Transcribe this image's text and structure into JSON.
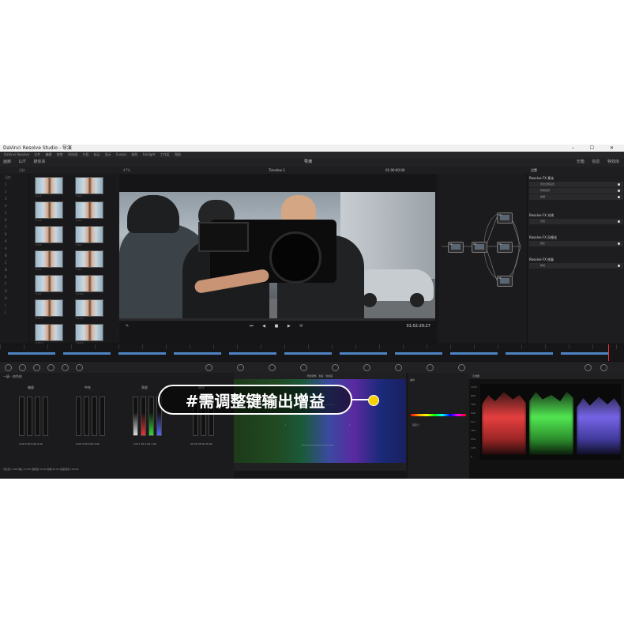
{
  "app": {
    "window_title": "DaVinci Resolve Studio - 导演",
    "menu": [
      "DaVinci Resolve",
      "文件",
      "编辑",
      "修剪",
      "时间线",
      "片段",
      "标记",
      "显示",
      "Fusion",
      "调色",
      "Fairlight",
      "工作区",
      "帮助"
    ]
  },
  "toolbar": {
    "left": [
      "画廊",
      "LUT",
      "媒体夹"
    ],
    "center": "导演",
    "right": [
      "光箱",
      "信息",
      "特效库"
    ]
  },
  "subbar": {
    "gallery_label": "记忆",
    "zoom": "47%",
    "timeline_name": "Timeline 1",
    "timecode": "01:00:00:00",
    "fx_tab": "设置"
  },
  "left_nav": [
    "记忆",
    "1",
    "2",
    "3",
    "4",
    "5",
    "6",
    "7",
    "8",
    "9",
    "A",
    "B",
    "C",
    "D",
    "E",
    "F",
    "G",
    "H",
    "I",
    "J"
  ],
  "gallery": {
    "stills": [
      "1.1.1",
      "1.2.1",
      "1.3.1",
      "1.4.1",
      "1.5.1",
      "1.6.1",
      "1.7.1",
      "1.8.1",
      "1.9.1",
      "1.10.1",
      "1.11.1",
      "1.12.1",
      "1.13.1",
      "1.14.1"
    ]
  },
  "viewer": {
    "timecode": "01:02:29:27",
    "transport": [
      "⏮",
      "◀",
      "■",
      "▶",
      "⟳"
    ]
  },
  "nodes": [
    "01",
    "02",
    "03",
    "04",
    "05",
    "06"
  ],
  "effects": {
    "sections": [
      {
        "title": "Resolve FX 柔化",
        "rows": [
          "导出全部设置",
          "特效名称",
          "模糊"
        ]
      },
      {
        "title": "Resolve FX 光线",
        "rows": [
          "光线"
        ]
      },
      {
        "title": "Resolve FX 风格化",
        "rows": [
          "锐化"
        ]
      },
      {
        "title": "Resolve FX 修复",
        "rows": [
          "降噪"
        ]
      }
    ]
  },
  "wheels": {
    "header": "一级 - 校色轮",
    "groups": [
      {
        "name": "暗部",
        "values": "0.00  0.00  0.00  0.00"
      },
      {
        "name": "中灰",
        "values": "0.00  0.00  0.00  0.00"
      },
      {
        "name": "亮部",
        "values": "1.00  1.00  1.00  1.00"
      },
      {
        "name": "偏移",
        "values": "25.00 25.00 25.00"
      }
    ],
    "footer": "对比度 1.000    轴心 0.435    饱和度 50.00    色相 50.00    亮度混合 100.00"
  },
  "vectorscope": {
    "header": "局部调整 - 色度 · 饱和度"
  },
  "curves": {
    "title": "曲线",
    "label": "自定义"
  },
  "scopes": {
    "header": "示波器",
    "axis": [
      "1023",
      "896",
      "768",
      "640",
      "512",
      "384",
      "256",
      "128",
      "0"
    ]
  },
  "callout": {
    "text": "#需调整键输出增益"
  },
  "colors": {
    "accent": "#f7d000",
    "clip": "#4f84c4",
    "playhead": "#e33333"
  }
}
